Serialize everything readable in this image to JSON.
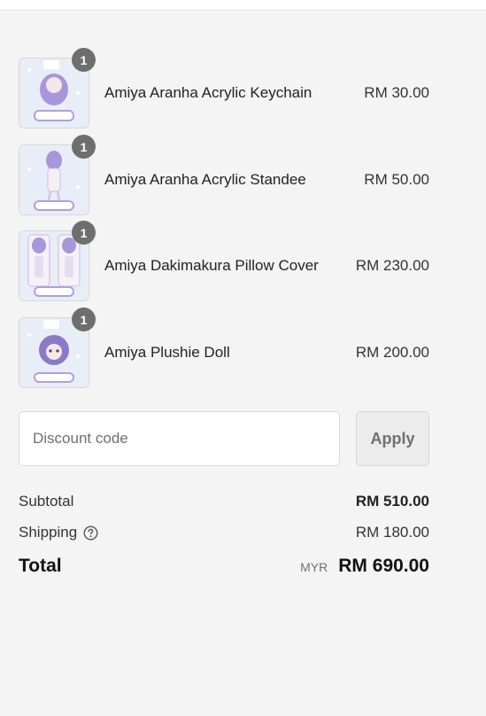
{
  "items": [
    {
      "name": "Amiya Aranha Acrylic Keychain",
      "price": "RM 30.00",
      "quantity": "1",
      "image_icon": "acrylic-keychain-thumbnail"
    },
    {
      "name": "Amiya Aranha Acrylic Standee",
      "price": "RM 50.00",
      "quantity": "1",
      "image_icon": "acrylic-standee-thumbnail"
    },
    {
      "name": "Amiya Dakimakura Pillow Cover",
      "price": "RM 230.00",
      "quantity": "1",
      "image_icon": "pillow-cover-thumbnail"
    },
    {
      "name": "Amiya Plushie Doll",
      "price": "RM 200.00",
      "quantity": "1",
      "image_icon": "plushie-doll-thumbnail"
    }
  ],
  "discount": {
    "placeholder": "Discount code",
    "apply_label": "Apply"
  },
  "totals": {
    "subtotal_label": "Subtotal",
    "subtotal_value": "RM 510.00",
    "shipping_label": "Shipping",
    "shipping_value": "RM 180.00",
    "total_label": "Total",
    "currency": "MYR",
    "total_value": "RM 690.00"
  },
  "colors": {
    "panel_background": "#f4f4f4",
    "quantity_badge": "#6e6e6e",
    "thumbnail_background": "#e7eef8",
    "thumbnail_accent": "#9a86d6"
  }
}
